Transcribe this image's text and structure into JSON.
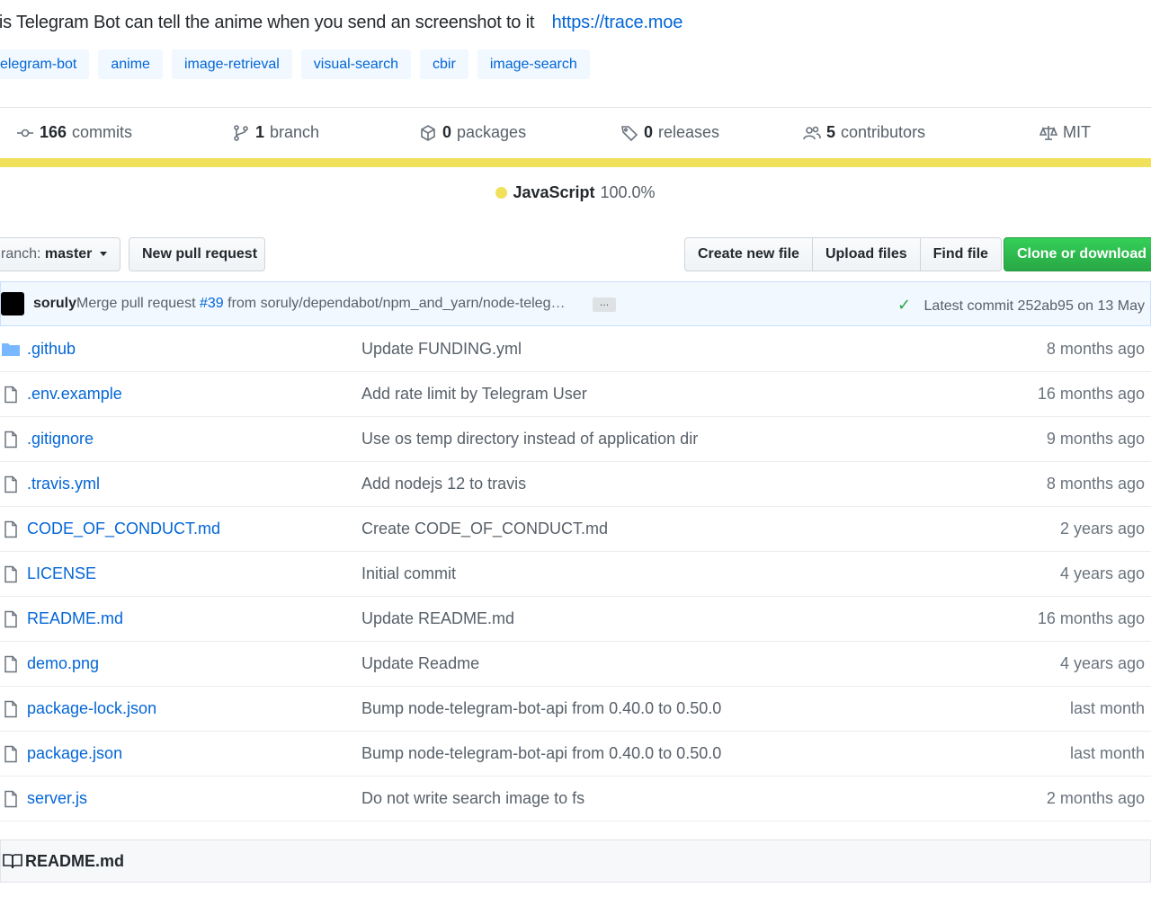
{
  "description": {
    "text": "his Telegram Bot can tell the anime when you send an screenshot to it",
    "link": "https://trace.moe"
  },
  "topics": [
    "elegram-bot",
    "anime",
    "image-retrieval",
    "visual-search",
    "cbir",
    "image-search"
  ],
  "summary": {
    "commits_count": "166",
    "commits_label": "commits",
    "branches_count": "1",
    "branches_label": "branch",
    "packages_count": "0",
    "packages_label": "packages",
    "releases_count": "0",
    "releases_label": "releases",
    "contributors_count": "5",
    "contributors_label": "contributors",
    "license": "MIT"
  },
  "language": {
    "name": "JavaScript",
    "percent": "100.0%",
    "color": "#f1e05a"
  },
  "toolbar": {
    "branch_label": "ranch:",
    "branch_name": "master",
    "new_pull_request": "New pull request",
    "create_new_file": "Create new file",
    "upload_files": "Upload files",
    "find_file": "Find file",
    "clone_or_download": "Clone or download"
  },
  "latest_commit": {
    "author": "soruly",
    "message_prefix": "Merge pull request",
    "pr": "#39",
    "message_suffix": "from soruly/dependabot/npm_and_yarn/node-teleg…",
    "ellipsis": "…",
    "latest_text": "Latest commit 252ab95 on 13 May"
  },
  "files": [
    {
      "name": ".github",
      "type": "dir",
      "message": "Update FUNDING.yml",
      "age": "8 months ago"
    },
    {
      "name": ".env.example",
      "type": "file",
      "message": "Add rate limit by Telegram User",
      "age": "16 months ago"
    },
    {
      "name": ".gitignore",
      "type": "file",
      "message": "Use os temp directory instead of application dir",
      "age": "9 months ago"
    },
    {
      "name": ".travis.yml",
      "type": "file",
      "message": "Add nodejs 12 to travis",
      "age": "8 months ago"
    },
    {
      "name": "CODE_OF_CONDUCT.md",
      "type": "file",
      "message": "Create CODE_OF_CONDUCT.md",
      "age": "2 years ago"
    },
    {
      "name": "LICENSE",
      "type": "file",
      "message": "Initial commit",
      "age": "4 years ago"
    },
    {
      "name": "README.md",
      "type": "file",
      "message": "Update README.md",
      "age": "16 months ago"
    },
    {
      "name": "demo.png",
      "type": "file",
      "message": "Update Readme",
      "age": "4 years ago"
    },
    {
      "name": "package-lock.json",
      "type": "file",
      "message": "Bump node-telegram-bot-api from 0.40.0 to 0.50.0",
      "age": "last month"
    },
    {
      "name": "package.json",
      "type": "file",
      "message": "Bump node-telegram-bot-api from 0.40.0 to 0.50.0",
      "age": "last month"
    },
    {
      "name": "server.js",
      "type": "file",
      "message": "Do not write search image to fs",
      "age": "2 months ago"
    }
  ],
  "readme": {
    "title": "README.md"
  }
}
